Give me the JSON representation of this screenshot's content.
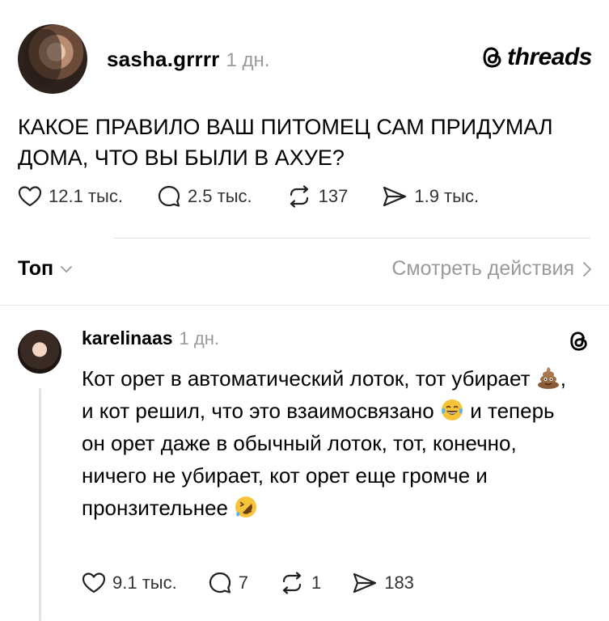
{
  "post": {
    "author": "sasha.grrrr",
    "time": "1 дн.",
    "brand": "threads",
    "text": "КАКОЕ ПРАВИЛО ВАШ ПИТОМЕЦ САМ ПРИДУМАЛ ДОМА, ЧТО ВЫ БЫЛИ В АХУЕ?",
    "likes": "12.1 тыс.",
    "comments": "2.5 тыс.",
    "reposts": "137",
    "shares": "1.9 тыс."
  },
  "sort": {
    "label": "Топ",
    "activity_link": "Смотреть действия"
  },
  "reply": {
    "author": "karelinaas",
    "time": "1 дн.",
    "text_1": "Кот орет в автоматический лоток, тот убирает ",
    "text_2": ", и кот решил, что это взаимосвязано ",
    "text_3": " и теперь он орет даже в обычный лоток, тот, конечно, ничего не убирает, кот орет еще громче и пронзительнее ",
    "likes": "9.1 тыс.",
    "comments": "7",
    "reposts": "1",
    "shares": "183"
  },
  "icons": {
    "like": "heart-icon",
    "comment": "comment-bubble-icon",
    "repost": "repost-icon",
    "share": "send-icon",
    "emoji_1": "pile-of-poo-emoji",
    "emoji_2": "tears-of-joy-emoji",
    "emoji_3": "rolling-on-floor-laughing-emoji"
  }
}
